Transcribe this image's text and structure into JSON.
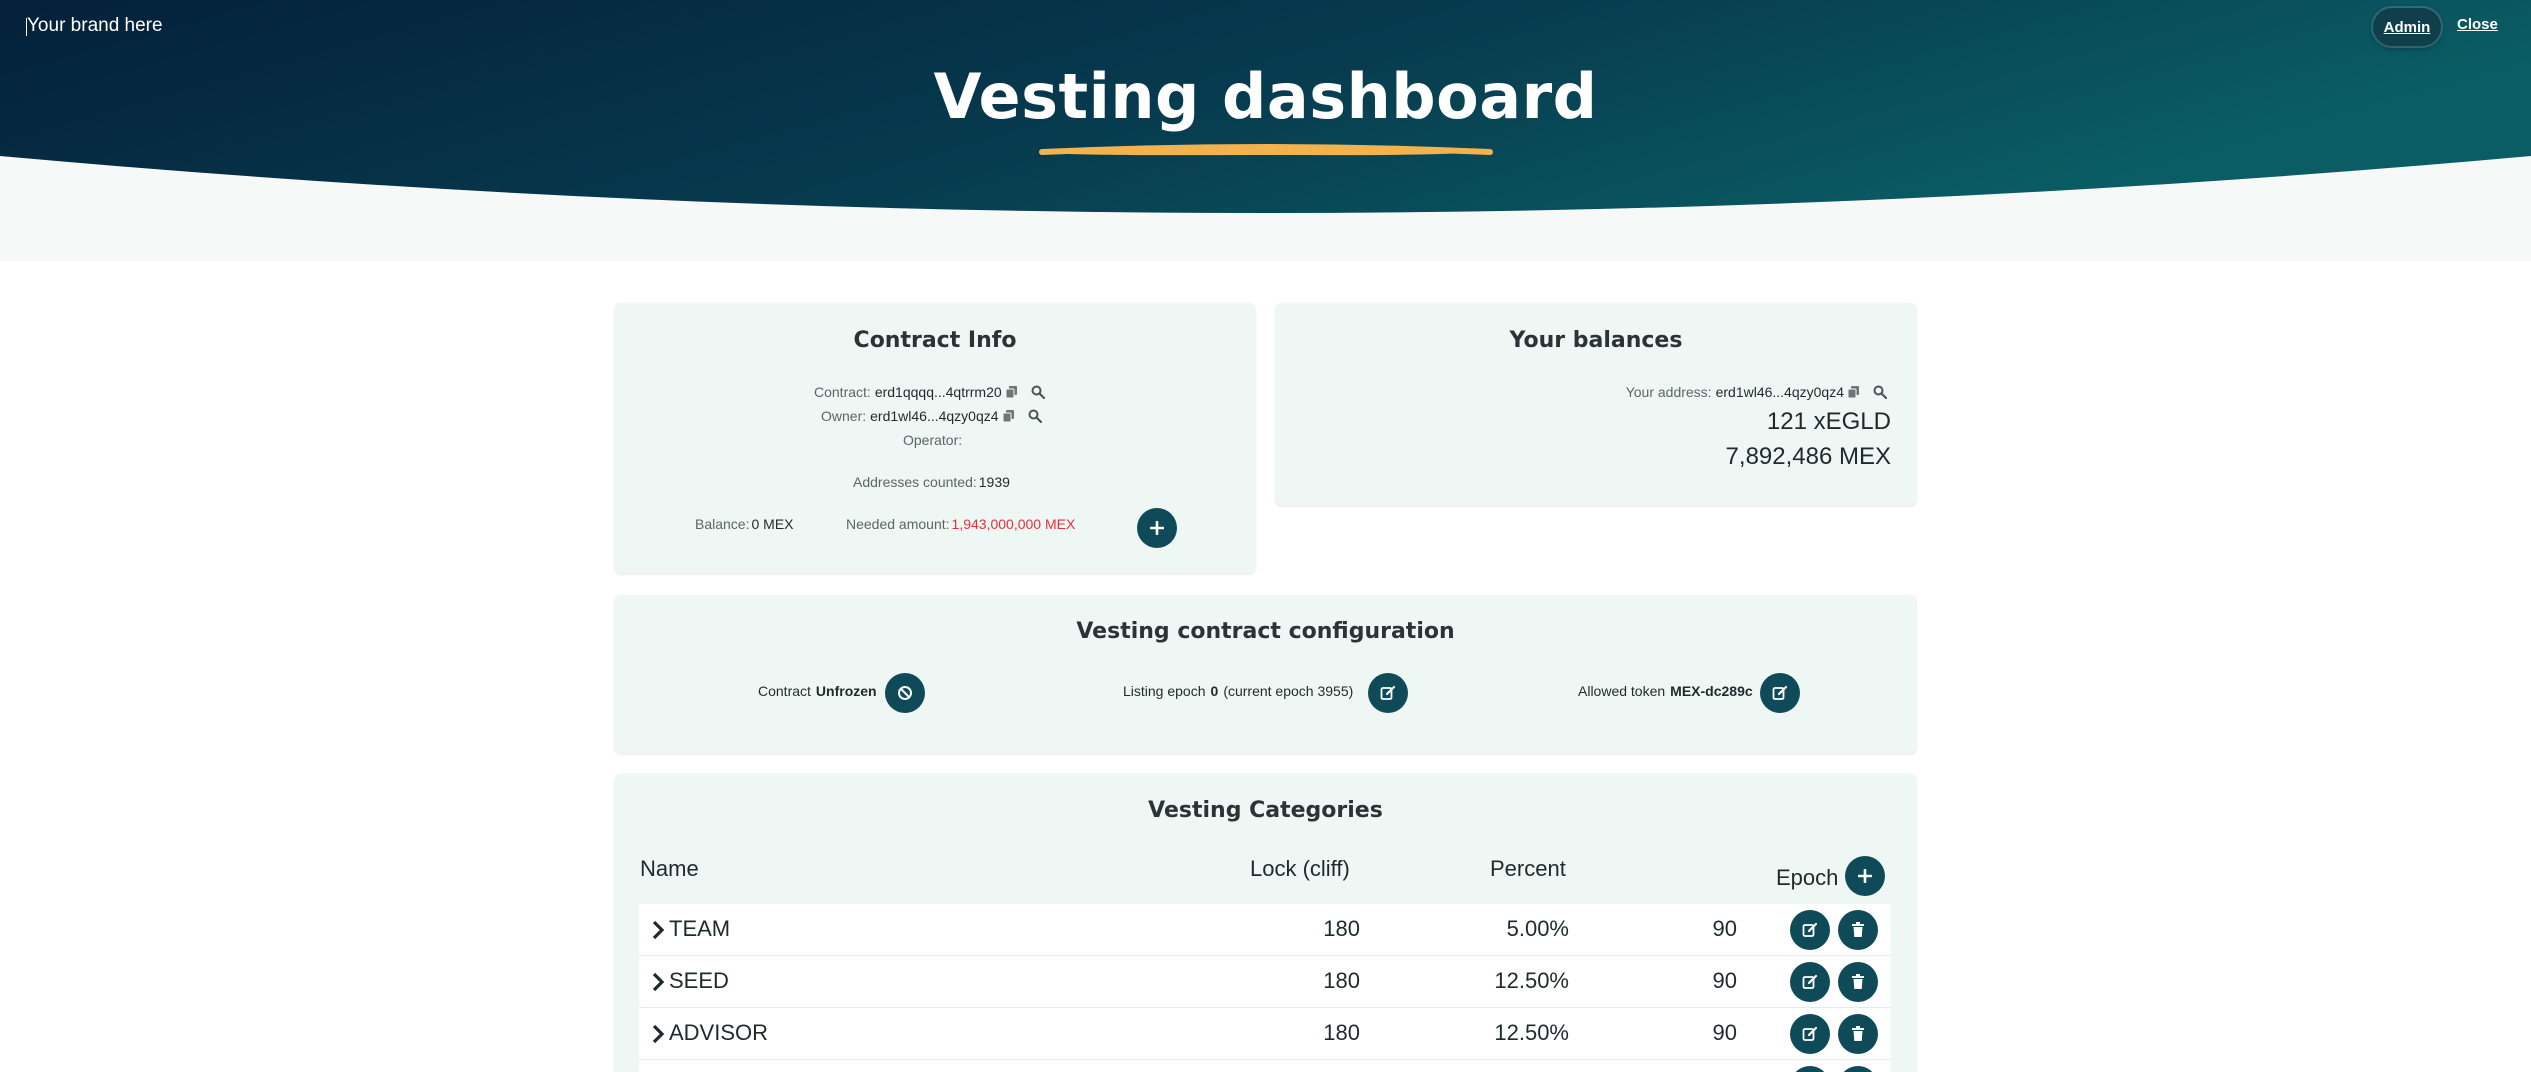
{
  "header": {
    "brand": "Your brand here",
    "admin_label": "Admin",
    "close_label": "Close",
    "title": "Vesting dashboard"
  },
  "colors": {
    "hero_dark": "#05243a",
    "hero_teal": "#0a5a62",
    "accent_underline": "#f2b24e",
    "button": "#0e4a57",
    "card_bg": "#eef7f4",
    "needed_red": "#e0323c"
  },
  "contract_info": {
    "title": "Contract Info",
    "contract_label": "Contract:",
    "contract_value": "erd1qqqq...4qtrrm20",
    "owner_label": "Owner:",
    "owner_value": "erd1wl46...4qzy0qz4",
    "operator_label": "Operator:",
    "operator_value": "",
    "addresses_label": "Addresses counted:",
    "addresses_value": "1939",
    "balance_label": "Balance:",
    "balance_value": "0 MEX",
    "needed_label": "Needed amount:",
    "needed_value": "1,943,000,000 MEX"
  },
  "balances": {
    "title": "Your balances",
    "address_label": "Your address:",
    "address_value": "erd1wl46...4qzy0qz4",
    "egld": "121 xEGLD",
    "mex": "7,892,486 MEX"
  },
  "config": {
    "title": "Vesting contract configuration",
    "contract_label": "Contract",
    "contract_state": "Unfrozen",
    "listing_label": "Listing epoch",
    "listing_value": "0",
    "listing_current": "(current epoch 3955)",
    "token_label": "Allowed token",
    "token_value": "MEX-dc289c"
  },
  "categories": {
    "title": "Vesting Categories",
    "headers": {
      "name": "Name",
      "lock": "Lock (cliff)",
      "percent": "Percent",
      "epoch": "Epoch"
    },
    "rows": [
      {
        "name": "TEAM",
        "lock": "180",
        "percent": "5.00%",
        "epoch": "90"
      },
      {
        "name": "SEED",
        "lock": "180",
        "percent": "12.50%",
        "epoch": "90"
      },
      {
        "name": "ADVISOR",
        "lock": "180",
        "percent": "12.50%",
        "epoch": "90"
      }
    ]
  },
  "icons": {
    "copy": "copy-icon",
    "search": "search-icon",
    "plus": "plus-icon",
    "freeze": "ban-icon",
    "edit": "edit-icon",
    "delete": "trash-icon",
    "chevron": "chevron-right-icon"
  }
}
